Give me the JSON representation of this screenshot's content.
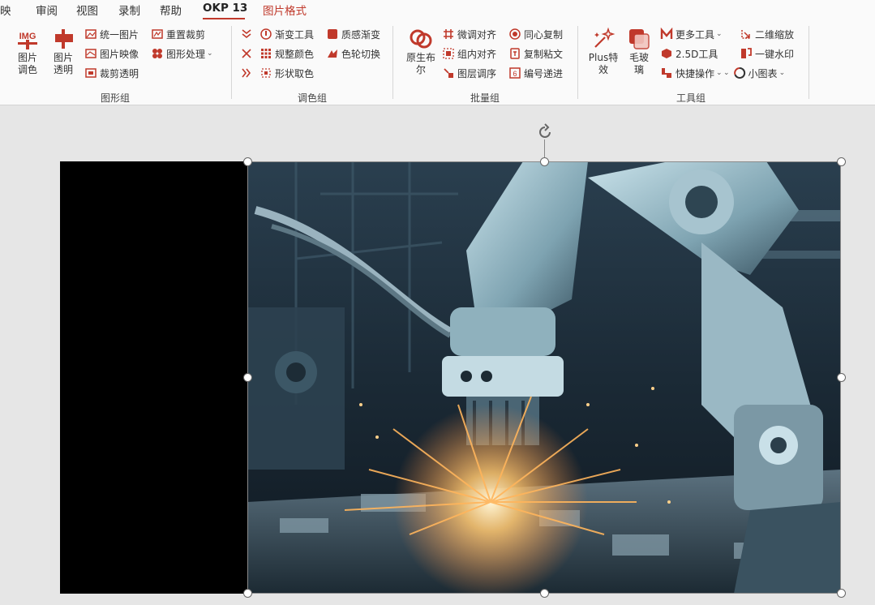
{
  "tabs": [
    {
      "label": "映"
    },
    {
      "label": "审阅"
    },
    {
      "label": "视图"
    },
    {
      "label": "录制"
    },
    {
      "label": "帮助"
    },
    {
      "label": "OKP 13"
    },
    {
      "label": "图片格式"
    }
  ],
  "ribbon": {
    "graphics_group": {
      "label": "图形组",
      "img_badge": "IMG",
      "buttons": [
        {
          "label": "图片\n调色"
        },
        {
          "label": "图片\n透明"
        }
      ],
      "items": [
        {
          "label": "统一图片"
        },
        {
          "label": "图片映像"
        },
        {
          "label": "裁剪透明"
        },
        {
          "label": "重置裁剪"
        },
        {
          "label": "图形处理"
        }
      ]
    },
    "color_group": {
      "label": "调色组",
      "items": [
        {
          "label": "渐变工具"
        },
        {
          "label": "规整颜色"
        },
        {
          "label": "形状取色"
        },
        {
          "label": "质感渐变"
        },
        {
          "label": "色轮切换"
        }
      ]
    },
    "batch_group": {
      "label": "批量组",
      "big_button": {
        "label": "原生布\n尔"
      },
      "items": [
        {
          "label": "微调对齐"
        },
        {
          "label": "组内对齐"
        },
        {
          "label": "图层调序"
        },
        {
          "label": "同心复制"
        },
        {
          "label": "复制粘文"
        },
        {
          "label": "编号递进"
        }
      ]
    },
    "tools_group": {
      "label": "工具组",
      "buttons": [
        {
          "label": "Plus特\n效"
        },
        {
          "label": "毛玻\n璃"
        }
      ],
      "items": [
        {
          "label": "更多工具"
        },
        {
          "label": "2.5D工具"
        },
        {
          "label": "快捷操作"
        },
        {
          "label": "二维缩放"
        },
        {
          "label": "一键水印"
        },
        {
          "label": "小图表"
        }
      ]
    }
  },
  "colors": {
    "accent": "#c0392b",
    "ribbon_bg": "#fafafa",
    "canvas_bg": "#e6e6e6",
    "slide_black": "#000000"
  },
  "image": {
    "description_name": "robot-arm-welding-photo"
  }
}
